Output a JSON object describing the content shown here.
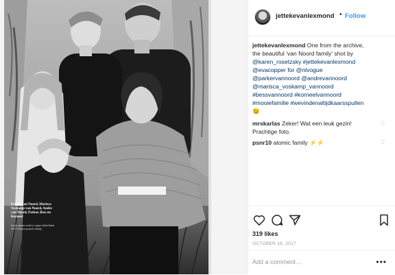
{
  "post": {
    "print_caption": "Parker van Noord, Marisca Voskamp-van Noord, Andre van Noord, Parker, Bess en Korneel",
    "print_small": "lorem ipsum archive vogue netherlands 2017 fashion portrait family"
  },
  "header": {
    "username": "jettekevanlexmond",
    "dot": "•",
    "follow_label": "Follow"
  },
  "caption": {
    "username": "jettekevanlexmond",
    "lines": [
      " One from the archive,",
      "the beautiful 'van Noord family' shot by",
      "@karen_rosetzsky #jettekevanlexmond",
      "@evacopper for @nlvogue",
      "@parkervannoord @andrevannoord",
      "@marisca_voskamp_vannoord",
      "#bessvannoord #korneelvannoord",
      "#mooiefamilie #wevindenaltijdkaarsspullen",
      "😉"
    ]
  },
  "comments": [
    {
      "username": "mrskarlas",
      "text": " Zeker! Wat een leuk gezin!",
      "text2": "Prachtige foto."
    },
    {
      "username": "psnr10",
      "text": " atomic family ⚡⚡",
      "text2": ""
    }
  ],
  "actions": {
    "like": "heart-icon",
    "comment": "comment-icon",
    "share": "share-icon",
    "save": "bookmark-icon"
  },
  "likes_text": "319 likes",
  "date_text": "OCTOBER 16, 2017",
  "add_comment": {
    "placeholder": "Add a comment…",
    "more": "•••"
  },
  "colors": {
    "link": "#003569",
    "follow": "#3897f0",
    "muted": "#999999",
    "border": "#efefef"
  }
}
